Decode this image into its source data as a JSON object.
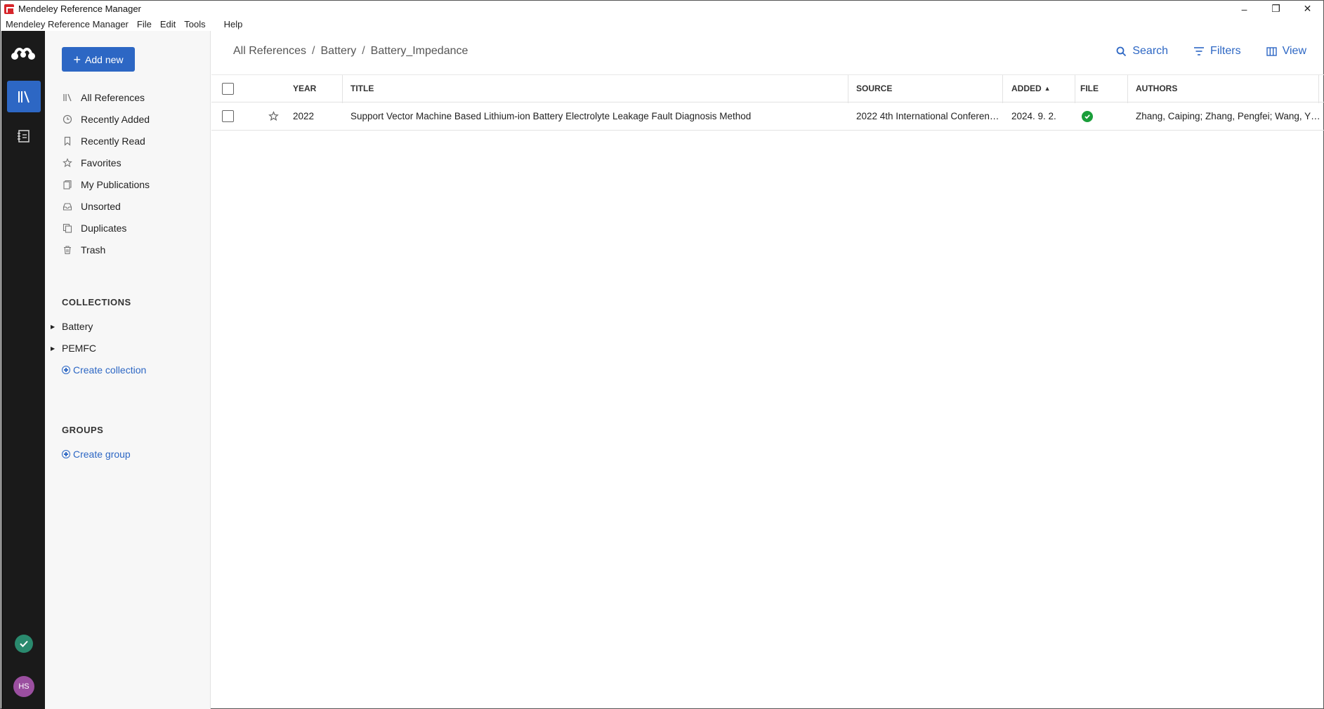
{
  "window": {
    "title": "Mendeley Reference Manager",
    "controls": [
      "–",
      "❐",
      "✕"
    ]
  },
  "menu": [
    "Mendeley Reference Manager",
    "File",
    "Edit",
    "Tools",
    "Help"
  ],
  "rail": {
    "avatar_initials": "HS"
  },
  "sidebar": {
    "add_new_label": "Add new",
    "nav": [
      {
        "label": "All References",
        "icon": "library-icon"
      },
      {
        "label": "Recently Added",
        "icon": "clock-icon"
      },
      {
        "label": "Recently Read",
        "icon": "bookmark-icon"
      },
      {
        "label": "Favorites",
        "icon": "star-icon"
      },
      {
        "label": "My Publications",
        "icon": "publications-icon"
      },
      {
        "label": "Unsorted",
        "icon": "tray-icon"
      },
      {
        "label": "Duplicates",
        "icon": "duplicates-icon"
      },
      {
        "label": "Trash",
        "icon": "trash-icon"
      }
    ],
    "collections_title": "COLLECTIONS",
    "collections": [
      "Battery",
      "PEMFC"
    ],
    "create_collection": "Create collection",
    "groups_title": "GROUPS",
    "create_group": "Create group"
  },
  "main": {
    "breadcrumb": [
      "All References",
      "Battery",
      "Battery_Impedance"
    ],
    "breadcrumb_sep": "/",
    "toolbar": {
      "search": "Search",
      "filters": "Filters",
      "view": "View"
    },
    "table": {
      "columns": {
        "year": "YEAR",
        "title": "TITLE",
        "source": "SOURCE",
        "added": "ADDED",
        "added_sort": "▲",
        "file": "FILE",
        "authors": "AUTHORS"
      },
      "rows": [
        {
          "year": "2022",
          "title": "Support Vector Machine Based Lithium-ion Battery Electrolyte Leakage Fault Diagnosis Method",
          "source": "2022 4th International Conferen…",
          "added": "2024. 9. 2.",
          "file": "available",
          "authors": "Zhang, Caiping; Zhang, Pengfei; Wang, Y…"
        }
      ]
    }
  },
  "colors": {
    "accent": "#2d67c4",
    "rail_bg": "#1a1a1a",
    "file_ok": "#1a9e3a",
    "avatar": "#9b4fa0",
    "sync": "#2a8a6e"
  }
}
